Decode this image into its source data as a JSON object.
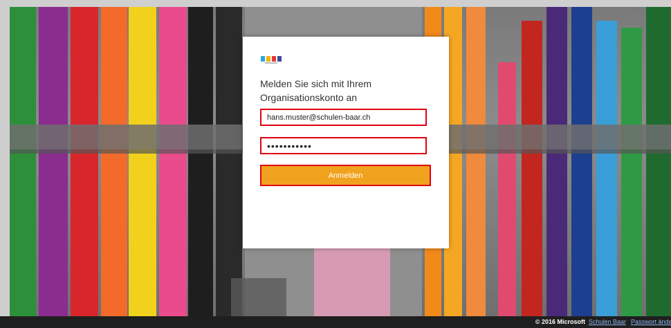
{
  "login": {
    "heading": "Melden Sie sich mit Ihrem Organisationskonto an",
    "email_value": "hans.muster@schulen-baar.ch",
    "password_value": "•••••••••••",
    "submit_label": "Anmelden"
  },
  "footer": {
    "copyright": "© 2016 Microsoft",
    "link_schools": "Schulen Baar",
    "link_password": "Passwort ändern"
  },
  "colors": {
    "accent": "#f0a21e",
    "highlight": "#e00012",
    "footer_bg": "#1f1f1f"
  },
  "icons": {
    "logo": "schulen-baar-logo"
  }
}
